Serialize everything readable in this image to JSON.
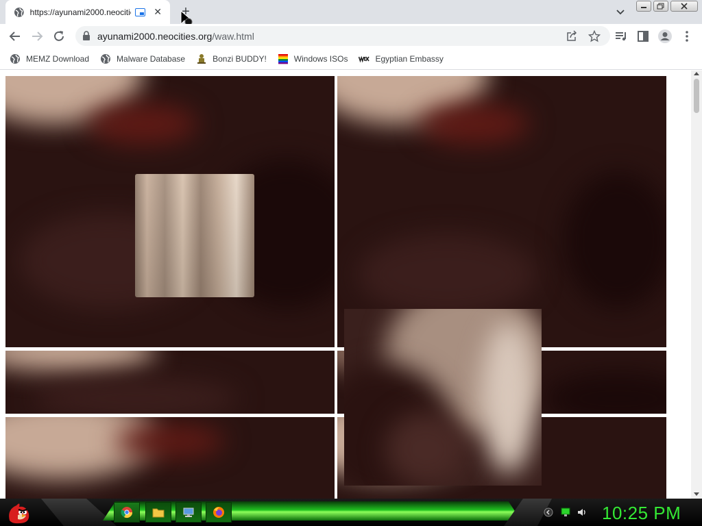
{
  "tab": {
    "title": "https://ayunami2000.neocities.org/waw.html"
  },
  "address_bar": {
    "host": "ayunami2000.neocities.org",
    "path": "/waw.html"
  },
  "bookmarks": [
    {
      "label": "MEMZ Download",
      "icon": "globe-icon"
    },
    {
      "label": "Malware Database",
      "icon": "globe-icon"
    },
    {
      "label": "Bonzi BUDDY!",
      "icon": "bonzi-icon"
    },
    {
      "label": "Windows ISOs",
      "icon": "windows-flag-icon"
    },
    {
      "label": "Egyptian Embassy",
      "icon": "wix-icon"
    }
  ],
  "taskbar": {
    "clock": "10:25 PM",
    "apps": [
      "chrome-icon",
      "explorer-icon",
      "computer-icon",
      "firefox-icon"
    ]
  },
  "colors": {
    "chrome_tab_strip": "#dee1e6",
    "clock_green": "#34e834",
    "tile_dark": "#2a1311"
  }
}
